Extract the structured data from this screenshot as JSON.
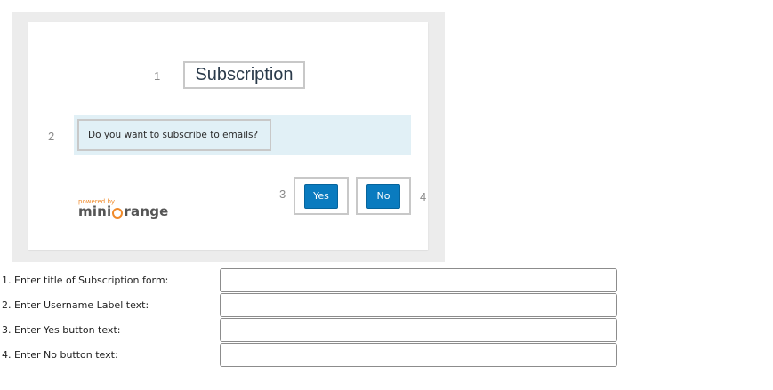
{
  "preview": {
    "number_1": "1",
    "title": "Subscription",
    "number_2": "2",
    "question": "Do you want to subscribe to emails?",
    "number_3": "3",
    "yes_label": "Yes",
    "no_label": "No",
    "number_4": "4",
    "logo_powered": "powered by",
    "logo_brand_prefix": "mini",
    "logo_brand_suffix": "range"
  },
  "form": {
    "fields": [
      {
        "label": "1. Enter title of Subscription form:",
        "value": "",
        "placeholder": ""
      },
      {
        "label": "2. Enter Username Label text:",
        "value": "",
        "placeholder": ""
      },
      {
        "label": "3. Enter Yes button text:",
        "value": "",
        "placeholder": ""
      },
      {
        "label": "4. Enter No button text:",
        "value": "",
        "placeholder": ""
      }
    ]
  },
  "colors": {
    "button_blue": "#0a7bbf",
    "band_blue": "#e1f0f6",
    "logo_orange": "#f08a2a"
  }
}
